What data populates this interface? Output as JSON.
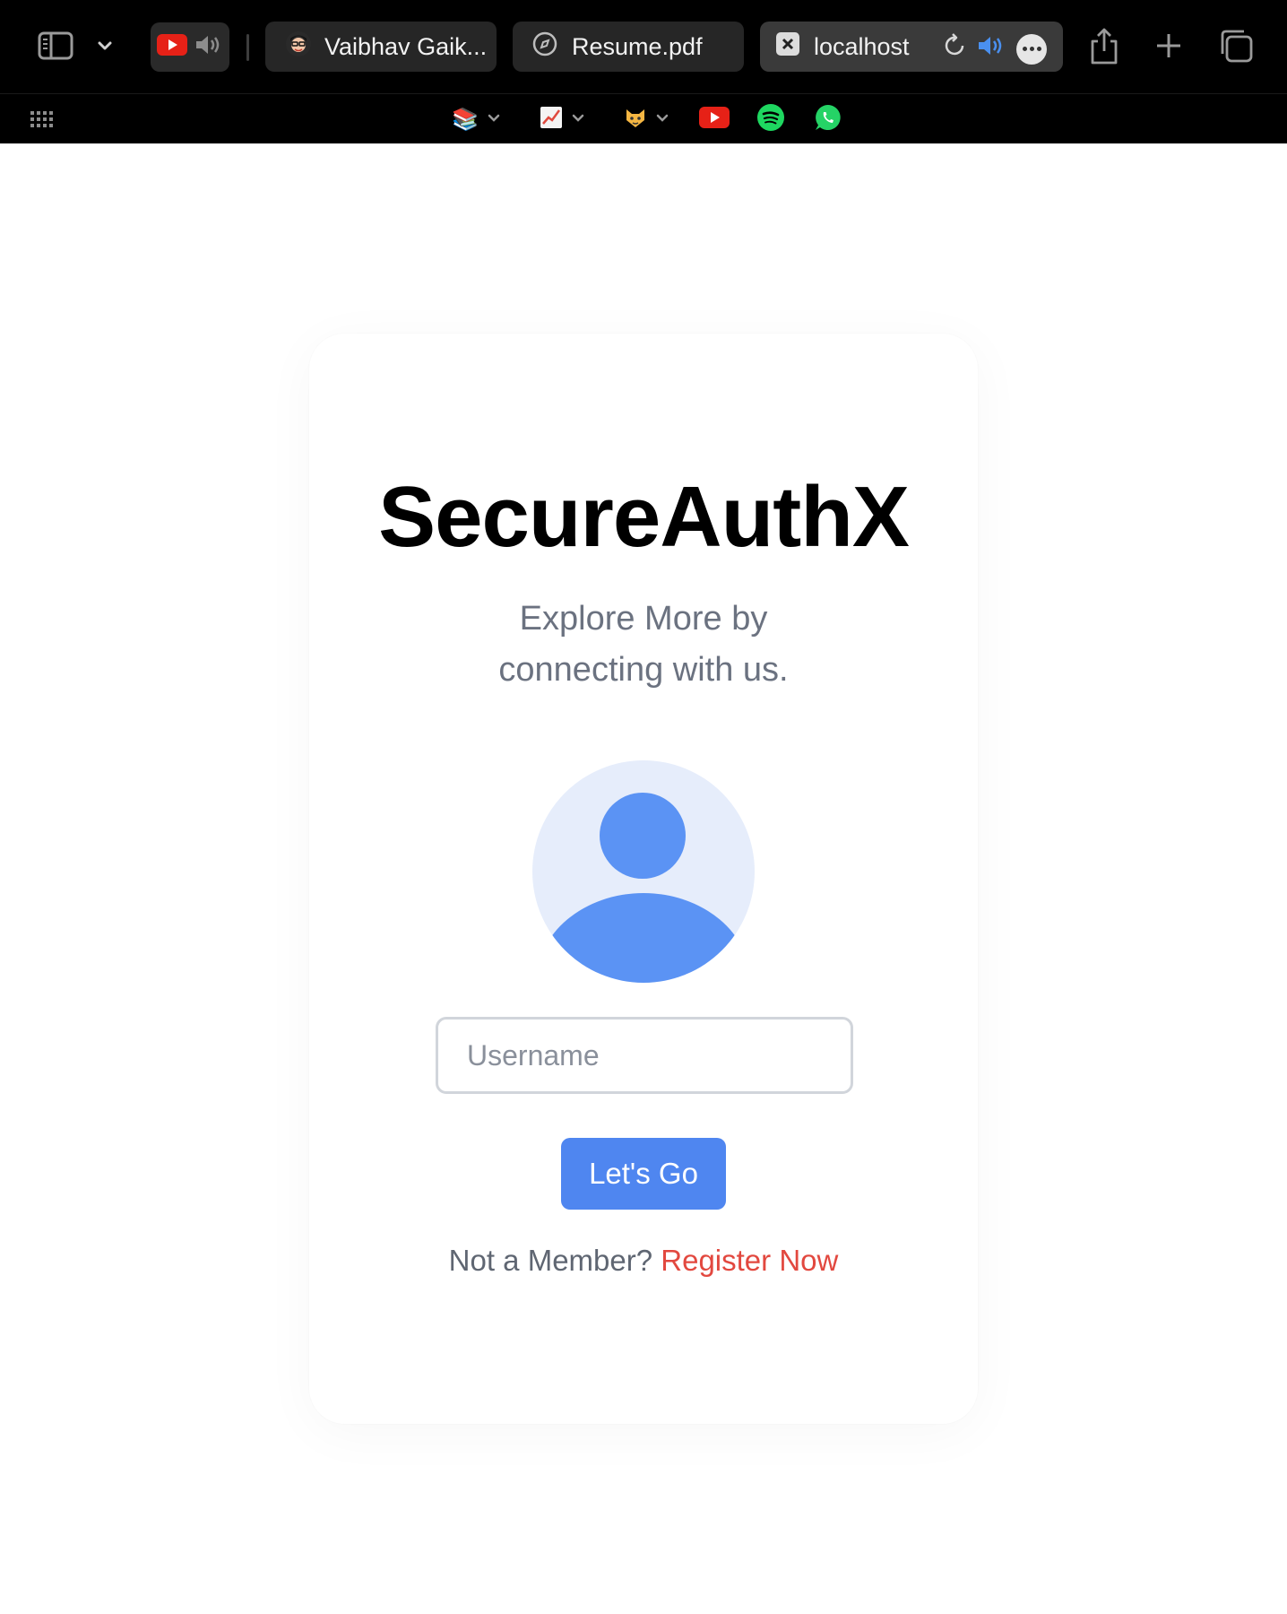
{
  "browser": {
    "tabs": [
      {
        "label": "Vaibhav Gaik...",
        "icon": "avatar-favicon"
      },
      {
        "label": "Resume.pdf",
        "icon": "compass-icon"
      },
      {
        "label": "localhost",
        "icon": "close-x-icon",
        "active": true
      }
    ],
    "bookmarks": [
      "books",
      "chart",
      "cat",
      "youtube",
      "spotify",
      "whatsapp"
    ]
  },
  "login": {
    "title": "SecureAuthX",
    "subtitle_line1": "Explore More by",
    "subtitle_line2": "connecting with us.",
    "username_placeholder": "Username",
    "username_value": "",
    "submit_label": "Let's Go",
    "member_prompt": "Not a Member?",
    "register_label": "Register Now"
  },
  "colors": {
    "accent": "#4f86f0",
    "avatar_fill": "#5b93f4",
    "avatar_bg": "#e6edfb",
    "link": "#e2483f",
    "muted_text": "#6b7280"
  }
}
